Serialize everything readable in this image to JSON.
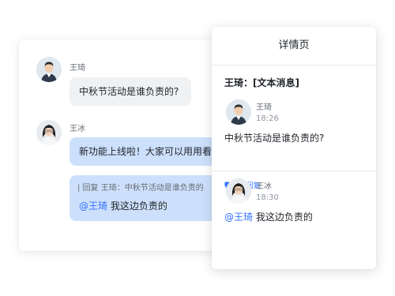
{
  "chat": {
    "messages": [
      {
        "sender": "王琦",
        "text": "中秋节活动是谁负责的?"
      },
      {
        "sender": "王冰",
        "text": "新功能上线啦！大家可以用用看",
        "reply_quote": "| 回复 王琦：中秋节活动是谁负责的",
        "reply_mention": "@王琦",
        "reply_text": " 我这边负责的"
      }
    ]
  },
  "detail": {
    "title": "详情页",
    "heading": "王琦：[文本消息]",
    "items": [
      {
        "name": "王琦",
        "time": "18:26",
        "text": "中秋节活动是谁负责的?",
        "reply_count": "1条回复"
      },
      {
        "name": "王冰",
        "time": "18:30",
        "mention": "@王琦",
        "text": " 我这边负责的"
      }
    ]
  },
  "colors": {
    "accent": "#3370ff",
    "bubble_blue": "#cde0fb",
    "bubble_gray": "#f0f1f3"
  }
}
